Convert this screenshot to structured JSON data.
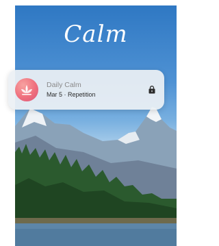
{
  "app": {
    "logo_text": "Calm"
  },
  "notification": {
    "title": "Daily Calm",
    "subtitle": "Mar 5 · Repetition",
    "icon": "calm-app-icon",
    "action_icon": "lock-icon"
  },
  "colors": {
    "sky_top": "#2f78c3",
    "notification_bg": "#ecf0f4",
    "icon_pink": "#ef6f7d"
  }
}
